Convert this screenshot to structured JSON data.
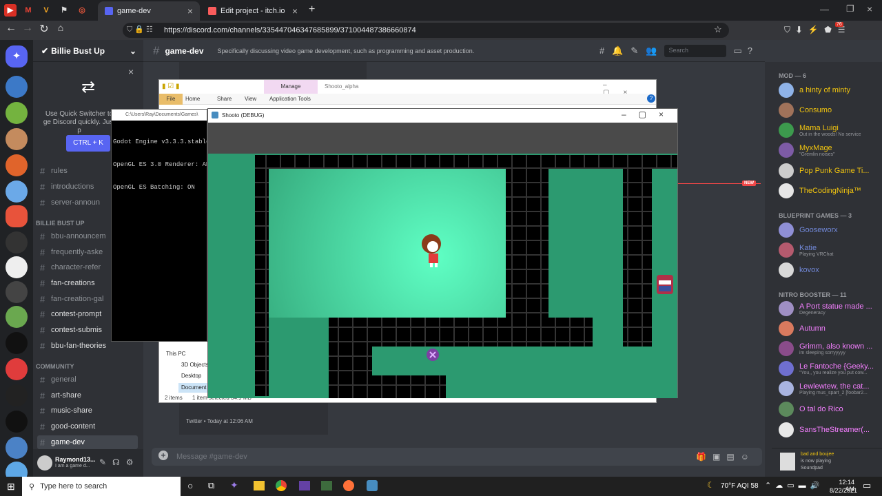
{
  "browser": {
    "tabs": [
      {
        "label": "game-dev",
        "active": true
      },
      {
        "label": "Edit project - itch.io",
        "active": false
      }
    ],
    "pinned": [
      "M",
      "V"
    ],
    "url": "https://discord.com/channels/335447046347685899/371004487386660874",
    "ext_badge": "76"
  },
  "discord": {
    "server_name": "Billie Bust Up",
    "channel_title": "game-dev",
    "channel_topic": "Specifically discussing video game development, such as programming and asset production.",
    "search_placeholder": "Search",
    "quick_switcher": {
      "text": "Use Quick Switcher to ge Discord quickly. Just p",
      "button": "CTRL + K"
    },
    "channels_top": [
      "rules",
      "introductions",
      "server-announ"
    ],
    "category_bbu": "BILLIE BUST UP",
    "channels_bbu": [
      "bbu-announcem",
      "frequently-aske",
      "character-refer",
      "fan-creations",
      "fan-creation-gal",
      "contest-prompt",
      "contest-submis",
      "bbu-fan-theories"
    ],
    "category_community": "COMMUNITY",
    "channels_community": [
      "general",
      "art-share",
      "music-share",
      "good-content",
      "game-dev"
    ],
    "new_badge": "NEW",
    "message_placeholder": "Message #game-dev",
    "embed_footer": "Twitter • Today at 12:06 AM",
    "user": {
      "name": "Raymond13...",
      "status": "I am a game d..."
    },
    "members": {
      "mod_header": "MOD — 6",
      "mods": [
        {
          "name": "a hinty of minty",
          "sub": "",
          "color": "#f1c40f"
        },
        {
          "name": "Consumo",
          "sub": "",
          "color": "#f1c40f"
        },
        {
          "name": "Mama Luigi",
          "sub": "Out in the woods! No service",
          "color": "#f1c40f"
        },
        {
          "name": "MyxMage",
          "sub": "\"Gremlin noises\"",
          "color": "#f1c40f"
        },
        {
          "name": "Pop Punk Game Ti...",
          "sub": "",
          "color": "#f1c40f"
        },
        {
          "name": "TheCodingNinja™",
          "sub": "",
          "color": "#f1c40f"
        }
      ],
      "blueprint_header": "BLUEPRINT GAMES — 3",
      "blueprint": [
        {
          "name": "Gooseworx",
          "sub": "",
          "color": "#7289da"
        },
        {
          "name": "Katie",
          "sub": "Playing VRChat",
          "color": "#7289da"
        },
        {
          "name": "kovox",
          "sub": "",
          "color": "#7289da"
        }
      ],
      "nitro_header": "NITRO BOOSTER — 11",
      "nitro": [
        {
          "name": "A Port statue made ...",
          "sub": "Degeneracy",
          "color": "#f47fff"
        },
        {
          "name": "Autumn",
          "sub": "",
          "color": "#f47fff"
        },
        {
          "name": "Grimm, also known ...",
          "sub": "im sleeping sorryyyyy",
          "color": "#f47fff"
        },
        {
          "name": "Le Fantoche {Geeky...",
          "sub": "\"You,, you realize you put cow...",
          "color": "#f47fff"
        },
        {
          "name": "Lewlewtew, the cat...",
          "sub": "Playing mus_spart_2 [foobar2...",
          "color": "#f47fff"
        },
        {
          "name": "O tal do Rico",
          "sub": "",
          "color": "#f47fff"
        },
        {
          "name": "SansTheStreamer(...",
          "sub": "",
          "color": "#f47fff"
        }
      ],
      "now_playing": {
        "line1": "bad and boujee",
        "line2": "is now playing",
        "line3": "Soundpad"
      }
    }
  },
  "explorer": {
    "tabs": [
      "File",
      "Home",
      "Share",
      "View",
      "Application Tools"
    ],
    "manage": "Manage",
    "title": "Shooto_alpha",
    "nav": [
      "This PC",
      "3D Objects",
      "Desktop",
      "Document"
    ],
    "status_items": "2 items",
    "status_selected": "1 item selected  34.9 MB"
  },
  "console": {
    "title": "C:\\Users\\Ray\\Documents\\Games\\",
    "lines": [
      "Godot Engine v3.3.3.stable",
      "OpenGL ES 3.0 Renderer: AM",
      "OpenGL ES Batching: ON"
    ]
  },
  "game": {
    "title": "Shooto (DEBUG)"
  },
  "taskbar": {
    "search_placeholder": "Type here to search",
    "weather": "70°F  AQI 58",
    "time": "12:14 AM",
    "date": "8/22/2021"
  }
}
